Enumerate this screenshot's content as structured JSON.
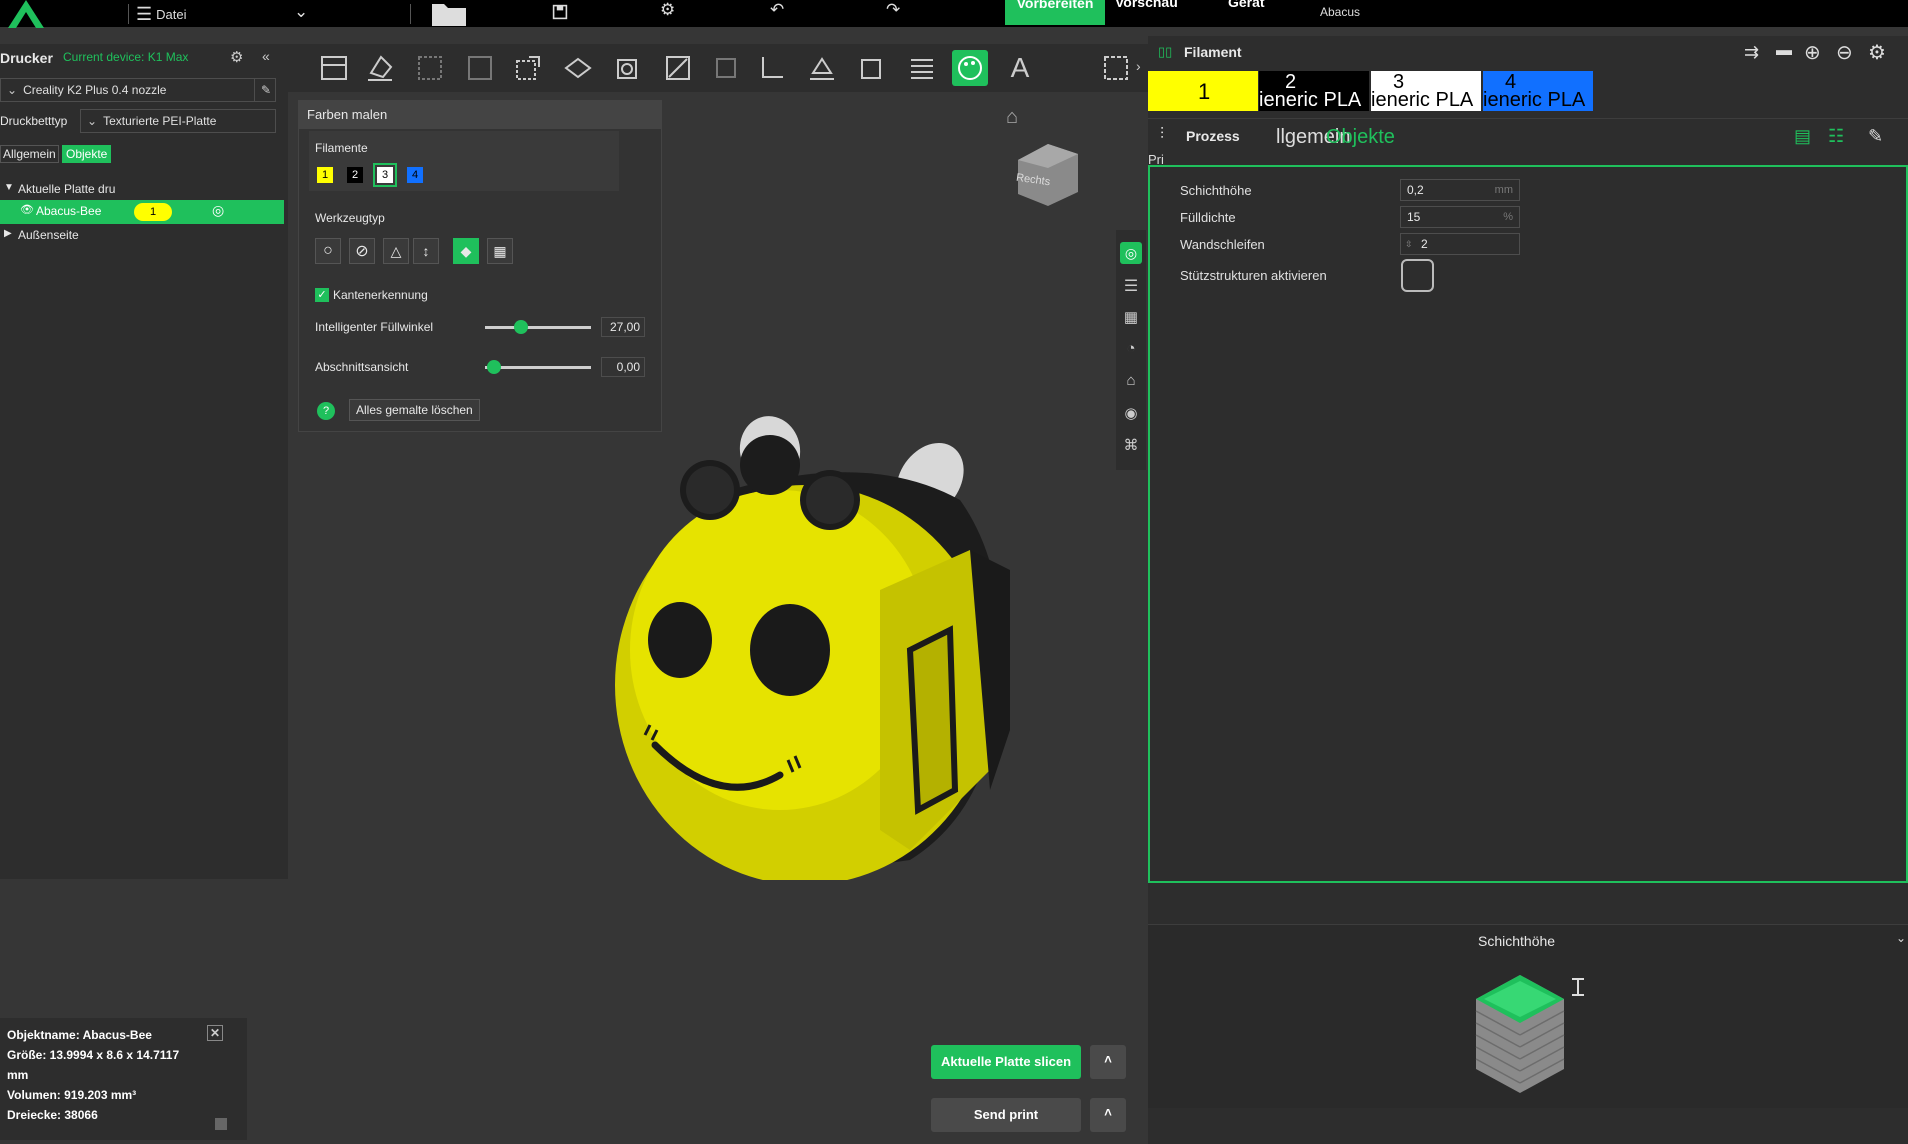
{
  "topbar": {
    "file_label": "Datei",
    "tabs": {
      "prepare": "Vorbereiten",
      "preview": "Vorschau",
      "device": "Gerät"
    },
    "project_name": "Abacus"
  },
  "left": {
    "printer_title": "Drucker",
    "current_device": "Current device: K1 Max",
    "printer_preset": "Creality K2 Plus 0.4 nozzle",
    "bed_type_label": "Druckbetttyp",
    "bed_type_value": "Texturierte PEI-Platte",
    "tab_general": "Allgemein",
    "tab_objects": "Objekte",
    "tree": {
      "plate": "Aktuelle Platte dru",
      "object": "Abacus-Bee",
      "object_badge": "1",
      "outside": "Außenseite"
    }
  },
  "paint": {
    "title": "Farben malen",
    "filaments_label": "Filamente",
    "filaments": [
      "1",
      "2",
      "3",
      "4"
    ],
    "tool_type_label": "Werkzeugtyp",
    "edge_detection_label": "Kantenerkennung",
    "smart_fill_label": "Intelligenter Füllwinkel",
    "smart_fill_value": "27,00",
    "section_view_label": "Abschnittsansicht",
    "section_view_value": "0,00",
    "clear_label": "Alles gemalte löschen"
  },
  "viewcube_label": "Rechts",
  "right": {
    "filament_title": "Filament",
    "filament_slots": [
      {
        "num": "1",
        "name": "",
        "color": "#ffff00",
        "text_color": "#000000"
      },
      {
        "num": "2",
        "name": "ieneric PLA",
        "color": "#000000",
        "text_color": "#ffffff"
      },
      {
        "num": "3",
        "name": "ieneric PLA",
        "color": "#ffffff",
        "text_color": "#000000"
      },
      {
        "num": "4",
        "name": "ieneric PLA",
        "color": "#1170ff",
        "text_color": "#000000"
      }
    ],
    "process_title": "Prozess",
    "process_tab_a": "llgemein",
    "process_tab_b": "Objekte",
    "process_sub": "Pri",
    "params": {
      "layer_height_label": "Schichthöhe",
      "layer_height_value": "0,2",
      "layer_height_unit": "mm",
      "infill_label": "Fülldichte",
      "infill_value": "15",
      "infill_unit": "%",
      "walls_label": "Wandschleifen",
      "walls_value": "2",
      "supports_label": "Stützstrukturen aktivieren"
    },
    "preview_title": "Schichthöhe"
  },
  "objinfo": {
    "name": "Objektname: Abacus-Bee",
    "size": "Größe: 13.9994 x 8.6 x 14.7117",
    "size_unit": "mm",
    "volume": "Volumen: 919.203 mm³",
    "triangles": "Dreiecke: 38066"
  },
  "buttons": {
    "slice": "Aktuelle Platte slicen",
    "send": "Send print"
  }
}
